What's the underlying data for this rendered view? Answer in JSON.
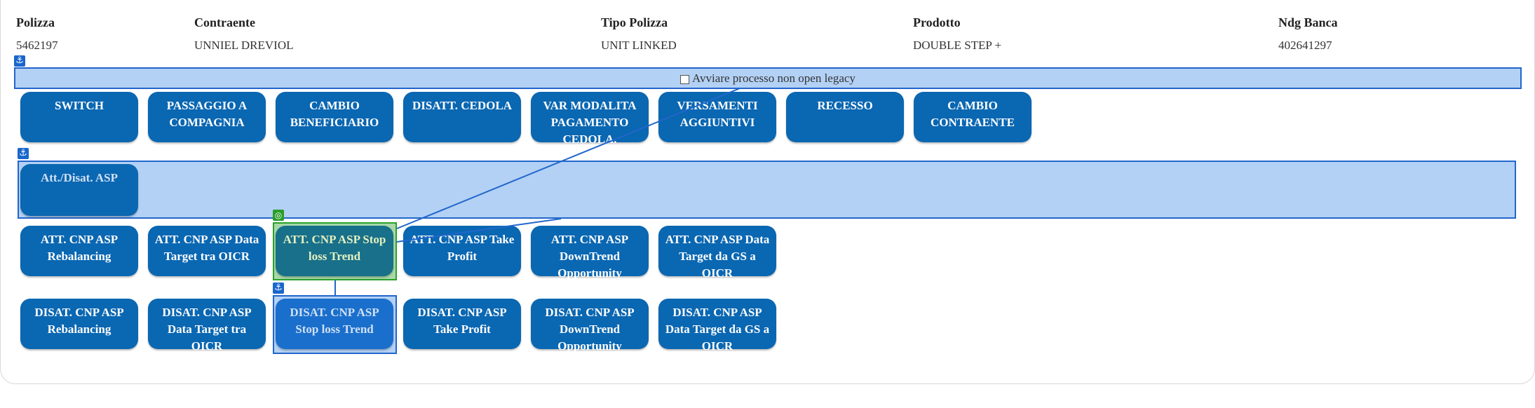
{
  "header": {
    "columns": [
      {
        "label": "Polizza",
        "value": "5462197"
      },
      {
        "label": "Contraente",
        "value": "UNNIEL DREVIOL"
      },
      {
        "label": "Tipo Polizza",
        "value": "UNIT LINKED"
      },
      {
        "label": "Prodotto",
        "value": "DOUBLE STEP +"
      },
      {
        "label": "Ndg Banca",
        "value": "402641297"
      }
    ]
  },
  "legacy_band": {
    "label": "Avviare processo non open legacy",
    "checked": false
  },
  "row1": [
    "SWITCH",
    "PASSAGGIO A COMPAGNIA",
    "CAMBIO BENEFICIARIO",
    "DISATT. CEDOLA",
    "VAR MODALITA PAGAMENTO CEDOLA.",
    "VERSAMENTI AGGIUNTIVI",
    "RECESSO",
    "CAMBIO CONTRAENTE"
  ],
  "asp_band": {
    "button": "Att./Disat. ASP"
  },
  "row3": [
    "ATT. CNP ASP Rebalancing",
    "ATT. CNP ASP Data Target tra OICR",
    "ATT. CNP ASP Stop loss Trend",
    "ATT. CNP ASP Take Profit",
    "ATT. CNP ASP DownTrend Opportunity",
    "ATT. CNP ASP Data Target da GS a OICR"
  ],
  "row4": [
    "DISAT. CNP ASP Rebalancing",
    "DISAT. CNP ASP Data Target tra OICR",
    "DISAT. CNP ASP Stop loss Trend",
    "DISAT. CNP ASP Take Profit",
    "DISAT. CNP ASP DownTrend Opportunity",
    "DISAT. CNP ASP Data Target da GS a OICR"
  ],
  "icons": {
    "anchor": "anchor-icon",
    "target": "target-icon"
  },
  "colors": {
    "button": "#0a67b2",
    "band": "#b3d1f5",
    "band_border": "#2266cc",
    "selected_green": "#2aa12a"
  }
}
